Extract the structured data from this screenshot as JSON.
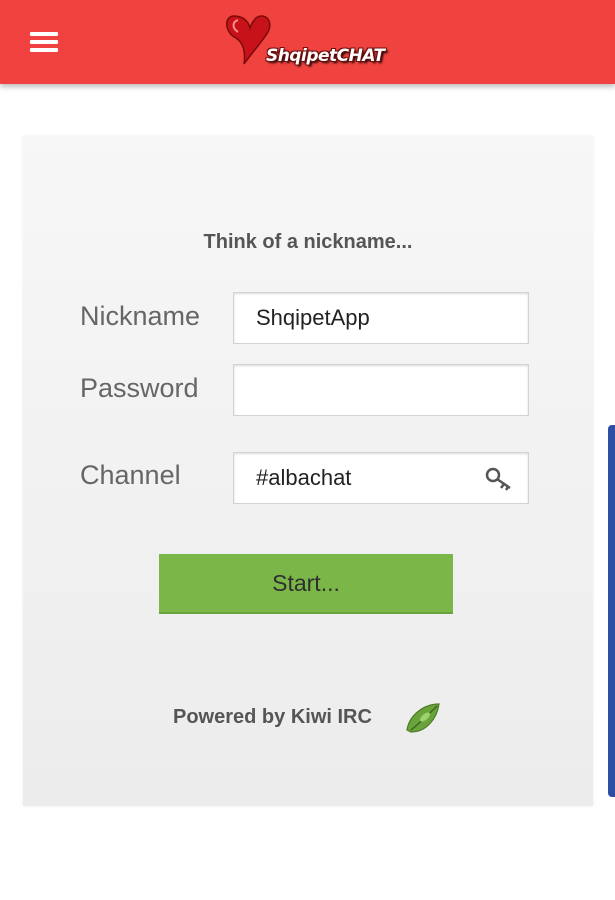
{
  "header": {
    "background_color": "#f0433f",
    "menu_icon": "hamburger-menu-icon",
    "logo_text": "ShqipetCHAT"
  },
  "login": {
    "heading": "Think of a nickname...",
    "nickname_label": "Nickname",
    "nickname_value": "ShqipetApp",
    "password_label": "Password",
    "password_value": "",
    "channel_label": "Channel",
    "channel_value": "#albachat",
    "channel_key_icon": "key-icon",
    "start_label": "Start...",
    "start_color": "#7ab648",
    "powered_by": "Powered by Kiwi IRC",
    "kiwi_logo_icon": "kiwi-leaf-icon"
  }
}
